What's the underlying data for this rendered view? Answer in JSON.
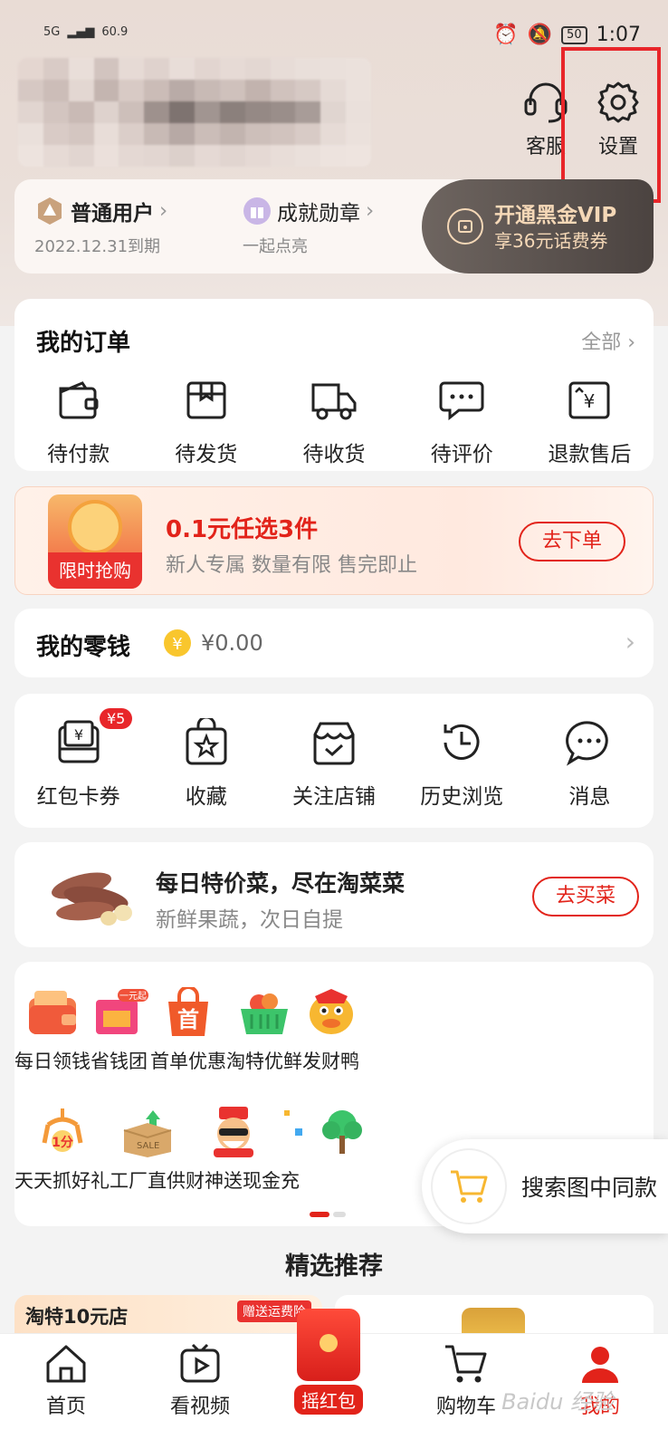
{
  "status": {
    "net_left": "5G",
    "speed": "60.9",
    "battery": "50",
    "time": "1:07"
  },
  "header": {
    "service_label": "客服",
    "settings_label": "设置"
  },
  "member": {
    "level_label": "普通用户",
    "level_expiry": "2022.12.31到期",
    "medal_label": "成就勋章",
    "medal_sub": "一起点亮",
    "vip_title": "开通黑金VIP",
    "vip_sub": "享36元话费券"
  },
  "orders": {
    "title": "我的订单",
    "all_label": "全部",
    "items": [
      {
        "label": "待付款",
        "icon": "wallet-icon"
      },
      {
        "label": "待发货",
        "icon": "package-icon"
      },
      {
        "label": "待收货",
        "icon": "truck-icon"
      },
      {
        "label": "待评价",
        "icon": "comment-icon"
      },
      {
        "label": "退款售后",
        "icon": "refund-icon"
      }
    ]
  },
  "promo": {
    "badge": "限时抢购",
    "title": "0.1元任选3件",
    "sub": "新人专属  数量有限 售完即止",
    "button": "去下单"
  },
  "wallet": {
    "title": "我的零钱",
    "amount": "¥0.00"
  },
  "tools": {
    "items": [
      {
        "label": "红包卡券",
        "badge": "¥5",
        "icon": "coupon-icon"
      },
      {
        "label": "收藏",
        "icon": "favorite-icon"
      },
      {
        "label": "关注店铺",
        "icon": "store-icon"
      },
      {
        "label": "历史浏览",
        "icon": "history-icon"
      },
      {
        "label": "消息",
        "icon": "message-icon"
      }
    ]
  },
  "fresh": {
    "title": "每日特价菜，尽在淘菜菜",
    "sub": "新鲜果蔬，次日自提",
    "button": "去买菜"
  },
  "services": {
    "row1": [
      {
        "label": "每日领钱",
        "icon": "money-wallet-icon"
      },
      {
        "label": "省钱团",
        "tag": "一元起",
        "icon": "group-buy-icon"
      },
      {
        "label": "首单优惠",
        "tag": "首",
        "icon": "first-order-bag-icon"
      },
      {
        "label": "淘特优鲜",
        "icon": "fruit-basket-icon"
      },
      {
        "label": "发财鸭",
        "icon": "duck-icon"
      }
    ],
    "row2": [
      {
        "label": "天天抓好礼",
        "tag": "1分",
        "icon": "claw-gift-icon"
      },
      {
        "label": "工厂直供",
        "tag": "SALE",
        "icon": "factory-box-icon"
      },
      {
        "label": "财神送现金",
        "icon": "fortune-god-icon"
      },
      {
        "label": "充",
        "icon": "recharge-icon"
      },
      {
        "label": "",
        "icon": "tree-icon"
      }
    ]
  },
  "float_search": {
    "label": "搜索图中同款"
  },
  "recommend": {
    "title": "精选推荐",
    "feed1_title": "淘特10元店",
    "feed1_tag": "赠送运费险"
  },
  "tabbar": {
    "items": [
      {
        "label": "首页"
      },
      {
        "label": "看视频"
      },
      {
        "label": "摇红包"
      },
      {
        "label": "购物车"
      },
      {
        "label": "我的"
      }
    ]
  },
  "colors": {
    "accent": "#e2231a",
    "highlight_box": "#e8262a",
    "vip_gold": "#f5d8b7"
  },
  "watermark": "Baidu 经验"
}
